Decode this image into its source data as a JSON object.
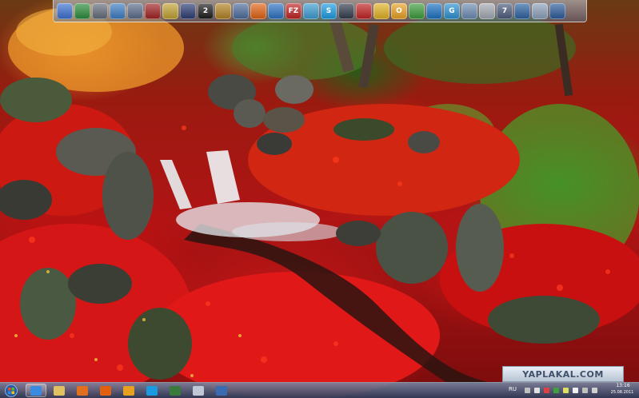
{
  "watermark": {
    "text": "YAPLAKAL.COM"
  },
  "dock": {
    "icons": [
      {
        "name": "computer-icon",
        "color": "#3a6fd0",
        "glyph": ""
      },
      {
        "name": "globe-icon",
        "color": "#2a8a3a",
        "glyph": ""
      },
      {
        "name": "media-icon",
        "color": "#606a78",
        "glyph": ""
      },
      {
        "name": "network-icon",
        "color": "#3a7ac0",
        "glyph": ""
      },
      {
        "name": "folder-icon",
        "color": "#5a6a8a",
        "glyph": ""
      },
      {
        "name": "disc-icon",
        "color": "#a02020",
        "glyph": ""
      },
      {
        "name": "tools-icon",
        "color": "#c0a030",
        "glyph": ""
      },
      {
        "name": "game-icon",
        "color": "#2a3a70",
        "glyph": ""
      },
      {
        "name": "2gis-icon",
        "color": "#1a1a1a",
        "glyph": "2"
      },
      {
        "name": "paint-icon",
        "color": "#b08020",
        "glyph": ""
      },
      {
        "name": "share-icon",
        "color": "#4a6a9a",
        "glyph": ""
      },
      {
        "name": "firefox-icon",
        "color": "#e06010",
        "glyph": ""
      },
      {
        "name": "teamviewer-icon",
        "color": "#2a70c0",
        "glyph": ""
      },
      {
        "name": "filezilla-icon",
        "color": "#c02020",
        "glyph": "FZ"
      },
      {
        "name": "window-icon",
        "color": "#3a9ad0",
        "glyph": ""
      },
      {
        "name": "skype-icon",
        "color": "#1a9ae0",
        "glyph": "S"
      },
      {
        "name": "video-icon",
        "color": "#303a4a",
        "glyph": ""
      },
      {
        "name": "red-box-icon",
        "color": "#c02020",
        "glyph": ""
      },
      {
        "name": "apps-icon",
        "color": "#e0b020",
        "glyph": ""
      },
      {
        "name": "outlook-icon",
        "color": "#e8a020",
        "glyph": "O"
      },
      {
        "name": "android-icon",
        "color": "#3a9a3a",
        "glyph": ""
      },
      {
        "name": "speed-icon",
        "color": "#1a70c0",
        "glyph": ""
      },
      {
        "name": "browser-icon",
        "color": "#2a90d0",
        "glyph": "G"
      },
      {
        "name": "doc-icon",
        "color": "#6a8ab0",
        "glyph": ""
      },
      {
        "name": "text-icon",
        "color": "#a0a8b0",
        "glyph": ""
      },
      {
        "name": "meter-icon",
        "color": "#4a5a7a",
        "glyph": "7"
      },
      {
        "name": "settings-icon",
        "color": "#2a60a0",
        "glyph": ""
      },
      {
        "name": "recycle-bin-icon",
        "color": "#8aa0b8",
        "glyph": ""
      },
      {
        "name": "monitor-icon",
        "color": "#2a5a9a",
        "glyph": ""
      }
    ]
  },
  "taskbar": {
    "buttons": [
      {
        "name": "ie-taskbar-button",
        "color": "#3a8ae0",
        "active": true
      },
      {
        "name": "explorer-taskbar-button",
        "color": "#e0c060",
        "active": false
      },
      {
        "name": "media-player-taskbar-button",
        "color": "#e07020",
        "active": false
      },
      {
        "name": "firefox-taskbar-button",
        "color": "#e06010",
        "active": false
      },
      {
        "name": "outlook-taskbar-button",
        "color": "#e8a020",
        "active": false
      },
      {
        "name": "skype-taskbar-button",
        "color": "#1a9ae0",
        "active": false
      },
      {
        "name": "task-manager-taskbar-button",
        "color": "#3a7a3a",
        "active": false
      },
      {
        "name": "mail-taskbar-button",
        "color": "#c0c8d8",
        "active": false
      },
      {
        "name": "window-taskbar-button",
        "color": "#3a6ab0",
        "active": false
      }
    ],
    "language": "RU",
    "clock_time": "13:16",
    "clock_date": "25.08.2011"
  },
  "tray_icons": [
    "#c0c0c0",
    "#e0e0e0",
    "#e04040",
    "#40a040",
    "#e0e060",
    "#f0f0f0",
    "#c0c0c0",
    "#d0d0d0"
  ]
}
